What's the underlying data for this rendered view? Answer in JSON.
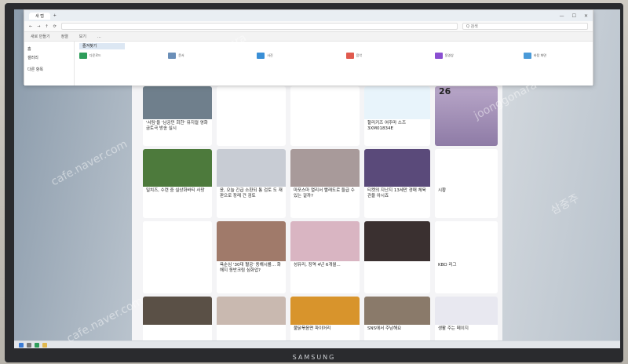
{
  "monitor": {
    "brand": "SAMSUNG"
  },
  "explorer": {
    "tab_title": "새 탭",
    "search_placeholder": "Q 검색",
    "cmd_items": [
      "새로 만들기",
      "정렬",
      "보기",
      "..."
    ],
    "side_items": [
      "홈",
      "갤러리",
      "",
      "다른 항목"
    ],
    "selected": "즐겨찾기",
    "folders": [
      {
        "label": "다운로드",
        "color": "#2e9d5a"
      },
      {
        "label": "문서",
        "color": "#6b8fb8"
      },
      {
        "label": "사진",
        "color": "#3a8fd6"
      },
      {
        "label": "음악",
        "color": "#e05a4e"
      },
      {
        "label": "동영상",
        "color": "#8a4fd1"
      },
      {
        "label": "바탕 화면",
        "color": "#4a9ad8"
      }
    ]
  },
  "news": {
    "row1": [
      {
        "caption": "'서팀'을 '남궁민 회한' 뮤지컬 영화 금토극 방송 실시",
        "img": "#6f7f8c"
      },
      {
        "caption": "",
        "img": "#ffffff"
      },
      {
        "caption": "",
        "img": "#ffffff"
      },
      {
        "caption": "할리키즈 여주마 스즈 3XM01834E",
        "img": "#e8f4fb"
      },
      {
        "weather": "26"
      }
    ],
    "row2": [
      {
        "caption": "밀치즈, 수련 중 실상화바티 사망",
        "img": "#4d7a3c"
      },
      {
        "caption": "윤, 오늘 긴급 소환되 통 검토 도 재판으로 장례 건 검토",
        "img": "#c8ccd4"
      },
      {
        "caption": "마포스마 열리서 빨래도로 들급 수 있는 걸까?",
        "img": "#a89a9a"
      },
      {
        "caption": "티켓의 지난지 13세만 경매 체육관을 아시죠",
        "img": "#5a4a7a"
      },
      {
        "caption": "시황",
        "img": "#ffffff"
      }
    ],
    "row3": [
      {
        "caption": "",
        "img": "#ffffff"
      },
      {
        "caption": "욕순심 '30대 혈궁' 동해시를... 화해지 동반크림 심화업?",
        "img": "#a07a6a"
      },
      {
        "caption": "성유리, 징역 4년 6개월...",
        "img": "#d9b5c2"
      },
      {
        "caption": "",
        "img": "#3a3030"
      },
      {
        "caption": "KBO 리그",
        "img": "#ffffff"
      }
    ],
    "row4": [
      {
        "caption": "",
        "img": "#5a5046"
      },
      {
        "caption": "",
        "img": "#c9b9b0"
      },
      {
        "caption": "불닭볶음면 파이어리",
        "img": "#d8942c"
      },
      {
        "caption": "SNS에서 주남해요",
        "img": "#8a7a6a"
      },
      {
        "caption": "생활 주는 페이지",
        "img": "#e8e8f0"
      }
    ]
  },
  "watermarks": [
    "cafe.naver.com",
    "joonggonara",
    "삼중주"
  ]
}
